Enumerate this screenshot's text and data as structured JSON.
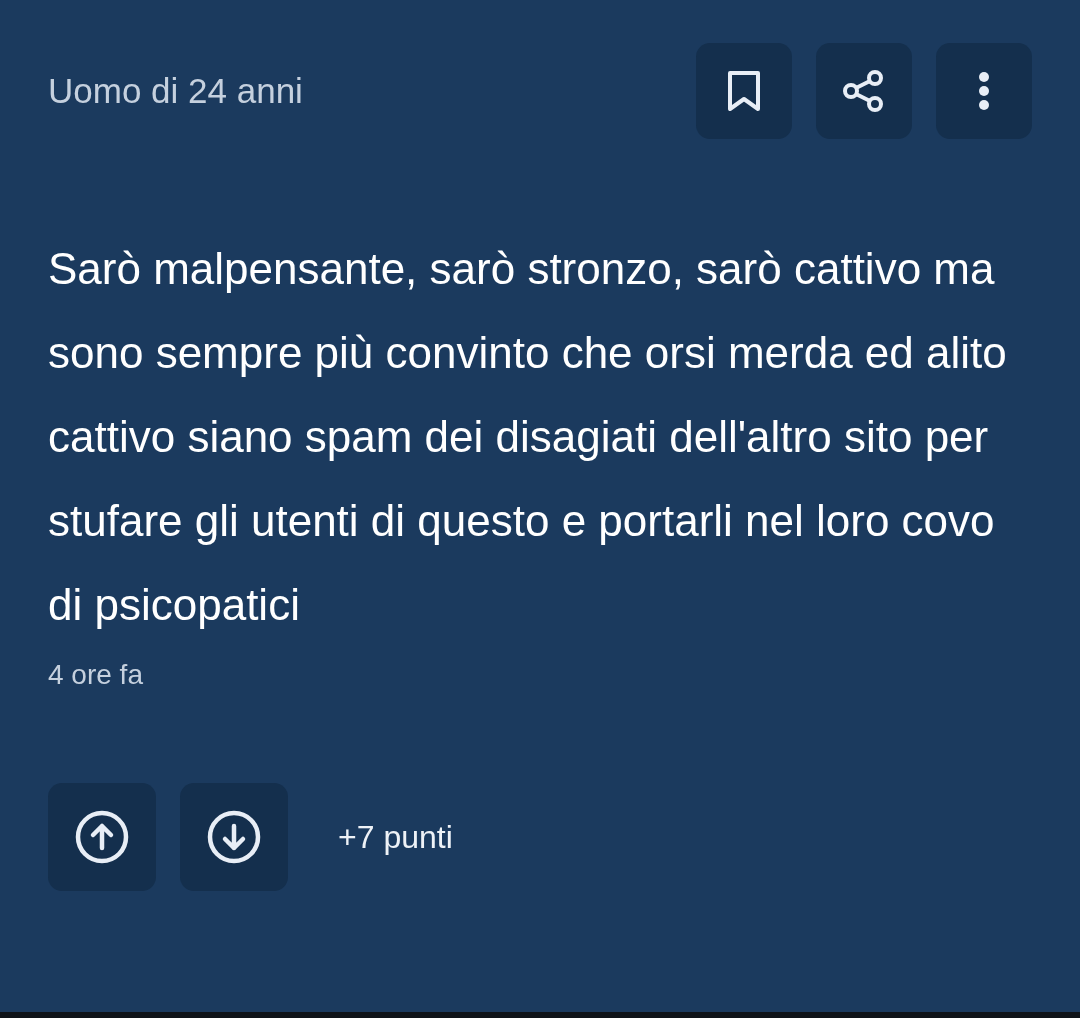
{
  "post": {
    "author": "Uomo di 24 anni",
    "actions": [
      {
        "kind": "bookmark"
      },
      {
        "kind": "share"
      },
      {
        "kind": "more"
      }
    ],
    "body": "Sarò malpensante, sarò stronzo, sarò cattivo ma sono sempre più convinto che orsi merda ed alito cattivo siano spam dei disagiati dell'altro sito per stufare gli utenti di questo e portarli nel loro covo di psicopatici",
    "time": "4 ore fa",
    "votes": [
      {
        "kind": "up"
      },
      {
        "kind": "down"
      }
    ],
    "score": "+7 punti"
  }
}
